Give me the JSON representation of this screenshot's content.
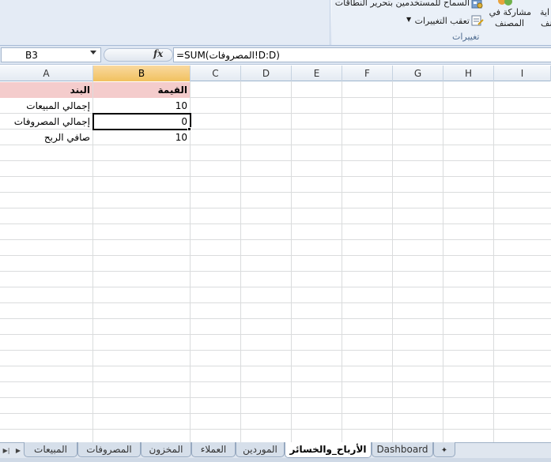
{
  "ribbon": {
    "allow_edit_ranges_label": "السماح للمستخدمين بتحرير النطاقات",
    "track_changes_label": "تعقب التغييرات",
    "share_workbook_label_1": "مشاركة في",
    "share_workbook_label_2": "المصنف",
    "protect_cut_label_1": "اية",
    "protect_cut_label_2": "نف",
    "group_label": "تغييرات"
  },
  "formula_bar": {
    "name_box": "B3",
    "fx_label": "fx",
    "formula": "=SUM(المصروفات!D:D)"
  },
  "grid": {
    "columns": [
      "A",
      "B",
      "C",
      "D",
      "E",
      "F",
      "G",
      "H",
      "I"
    ],
    "active_column": "B",
    "cells": {
      "A1": "البند",
      "B1": "القيمة",
      "A2": "إجمالي المبيعات",
      "B2": "10",
      "A3": "إجمالي المصروفات",
      "B3": "0",
      "A4": "صافي الربح",
      "B4": "10"
    },
    "header_fill_color": "#f4cccc",
    "active_header_color": "#f1c15f"
  },
  "sheet_tabs": [
    {
      "label": "المبيعات",
      "active": false
    },
    {
      "label": "المصروفات",
      "active": false
    },
    {
      "label": "المخزون",
      "active": false
    },
    {
      "label": "العملاء",
      "active": false
    },
    {
      "label": "الموردين",
      "active": false
    },
    {
      "label": "الأرباح_والخسائر",
      "active": true
    },
    {
      "label": "Dashboard",
      "active": false
    }
  ]
}
